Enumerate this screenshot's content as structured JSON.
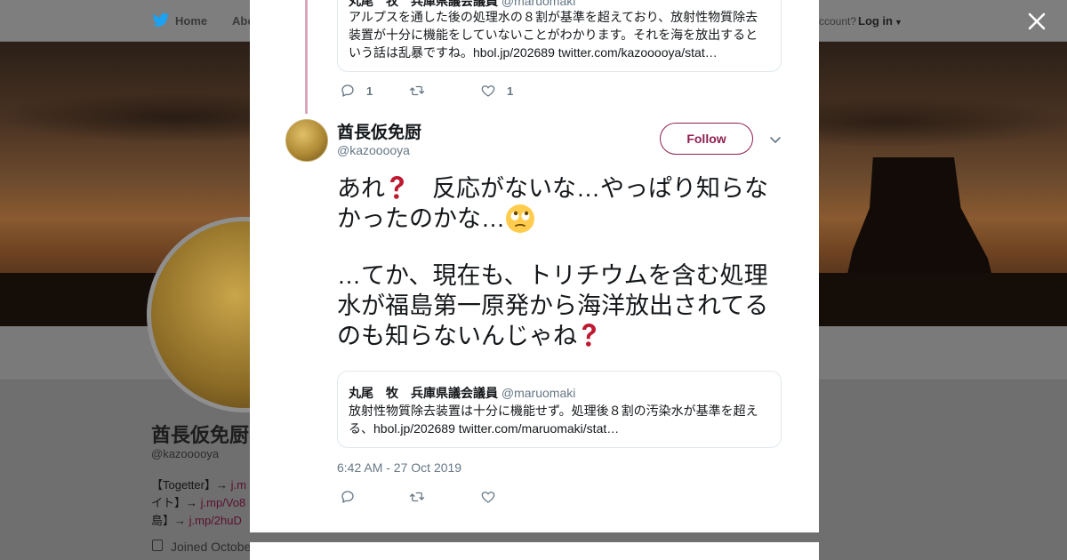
{
  "nav": {
    "home": "Home",
    "about": "Abo",
    "account_prompt": "ccount?",
    "login": "Log in"
  },
  "background_profile": {
    "name": "酋長仮免厨",
    "handle": "@kazooooya",
    "bio_line1_prefix": "【Togetter】→ ",
    "bio_line1_link": "j.m",
    "bio_line2_prefix": "イト】→ ",
    "bio_line2_link": "j.mp/Vo8",
    "bio_line3_prefix": "島】→ ",
    "bio_line3_link": "j.mp/2huD",
    "joined": "Joined Octobe"
  },
  "quoted_top": {
    "name": "丸尾　牧　兵庫県議会議員",
    "handle": "@maruomaki",
    "text": "アルプスを通した後の処理水の８割が基準を超えており、放射性物質除去装置が十分に機能をしていないことがわかります。それを海を放出するという話は乱暴ですね。hbol.jp/202689 twitter.com/kazooooya/stat…"
  },
  "top_actions": {
    "reply_count": "1",
    "retweet_count": "",
    "like_count": "1"
  },
  "tweet": {
    "author_name": "酋長仮免厨",
    "author_handle": "@kazooooya",
    "follow_label": "Follow",
    "para1_a": "あれ",
    "para1_b": "　反応がないな…やっぱり知らなかったのかな…",
    "para2": "…てか、現在も、トリチウムを含む処理水が福島第一原発から海洋放出されてるのも知らないんじゃね",
    "timestamp": "6:42 AM - 27 Oct 2019"
  },
  "quoted_bottom": {
    "name": "丸尾　牧　兵庫県議会議員",
    "handle": "@maruomaki",
    "text": "放射性物質除去装置は十分に機能せず。処理後８割の汚染水が基準を超える、hbol.jp/202689 twitter.com/maruomaki/stat…"
  },
  "icons": {
    "close": "close-icon",
    "reply": "reply-icon",
    "retweet": "retweet-icon",
    "like": "heart-icon",
    "caret": "chevron-down-icon"
  },
  "colors": {
    "accent": "#8f1f50",
    "thread_line": "#d9a6bd",
    "secondary_text": "#657786",
    "nav_bird": "#1da1f2"
  }
}
